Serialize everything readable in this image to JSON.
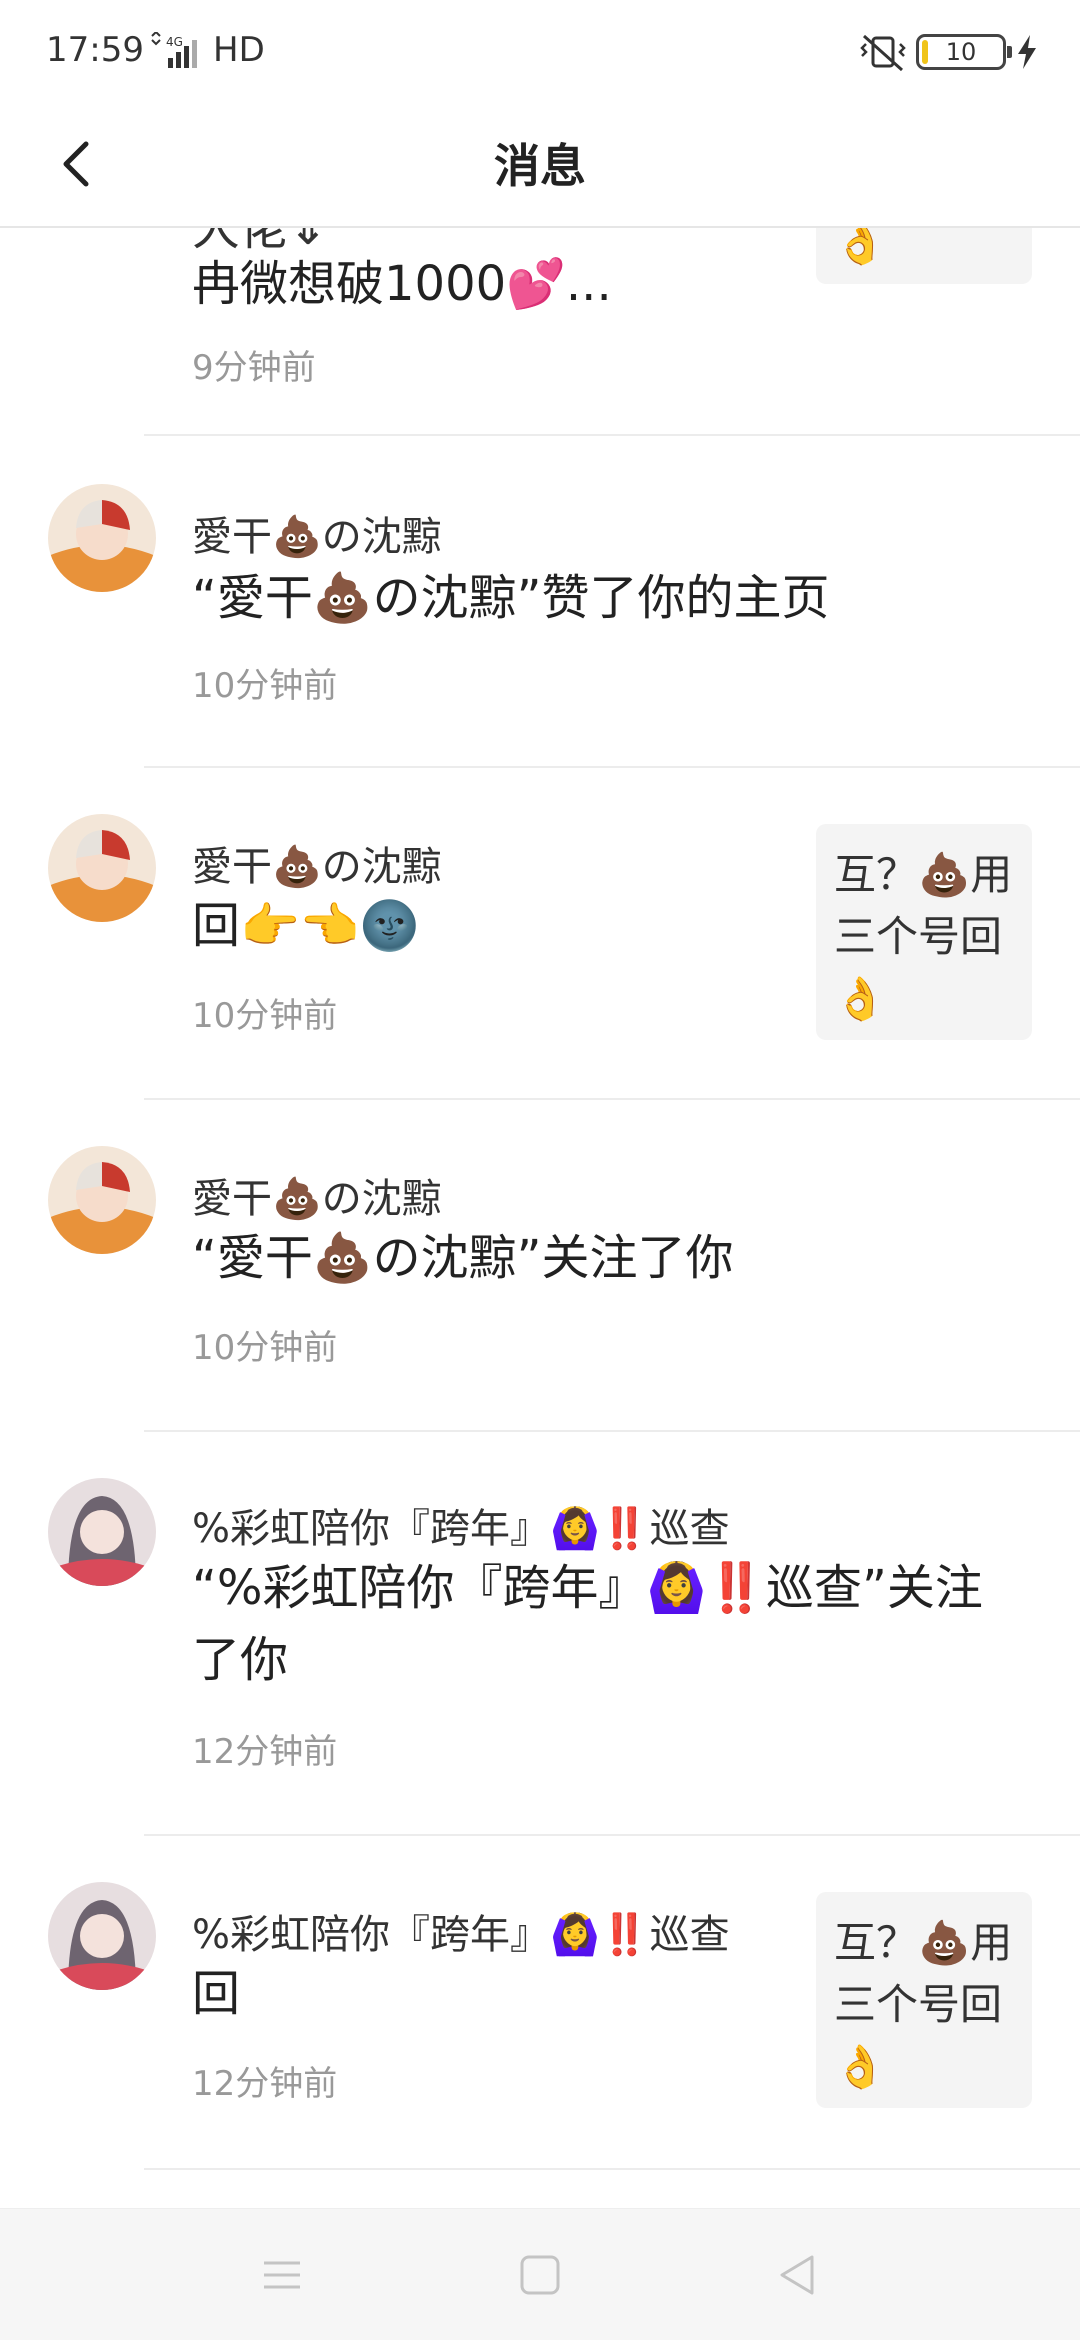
{
  "status_bar": {
    "time": "17:59",
    "network": "4G",
    "hd": "HD",
    "battery": "10",
    "icons": [
      "signal-icon",
      "vibrate-icon",
      "battery-icon",
      "charging-icon"
    ]
  },
  "nav": {
    "title": "消息",
    "back_icon": "chevron-left-icon"
  },
  "messages": [
    {
      "name": "大佬⇓",
      "content": "冉微想破1000💕...",
      "time": "9分钟前",
      "preview": "👌"
    },
    {
      "name": "愛干💩の沈黥",
      "content": "“愛干💩の沈黥”赞了你的主页",
      "time": "10分钟前"
    },
    {
      "name": "愛干💩の沈黥",
      "content": "回👉👈🌚",
      "time": "10分钟前",
      "preview": "互？💩用三个号回👌"
    },
    {
      "name": "愛干💩の沈黥",
      "content": "“愛干💩の沈黥”关注了你",
      "time": "10分钟前"
    },
    {
      "name": "%彩虹陪你『跨年』🙆‍♀️‼️巡查",
      "content": "“%彩虹陪你『跨年』🙆‍♀️‼️巡查”关注了你",
      "time": "12分钟前"
    },
    {
      "name": "%彩虹陪你『跨年』🙆‍♀️‼️巡查",
      "content": "回",
      "time": "12分钟前",
      "preview": "互？💩用三个号回👌"
    }
  ],
  "system_nav": [
    "menu-icon",
    "home-icon",
    "back-icon"
  ]
}
